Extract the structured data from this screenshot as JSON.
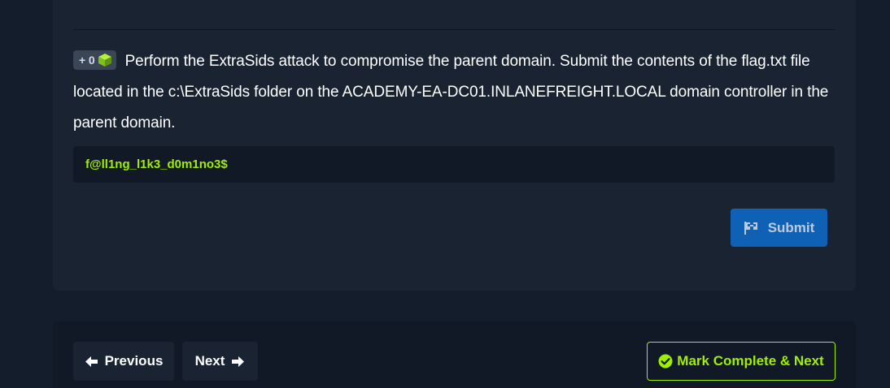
{
  "question": {
    "points_label": "+ 0",
    "points_icon": "cube-icon",
    "text": "Perform the ExtraSids attack to compromise the parent domain. Submit the contents of the flag.txt file located in the c:\\ExtraSids folder on the ACADEMY-EA-DC01.INLANEFREIGHT.LOCAL domain controller in the parent domain.",
    "answer_value": "f@ll1ng_l1k3_d0m1no3$",
    "submit_label": "Submit",
    "submit_icon": "flag-icon"
  },
  "navigation": {
    "previous_label": "Previous",
    "next_label": "Next",
    "mark_complete_label": "Mark Complete & Next"
  },
  "colors": {
    "page_background": "#141d2b",
    "card_background": "#1a2332",
    "accent_green": "#9fef00",
    "submit_blue": "#0f67c2"
  }
}
